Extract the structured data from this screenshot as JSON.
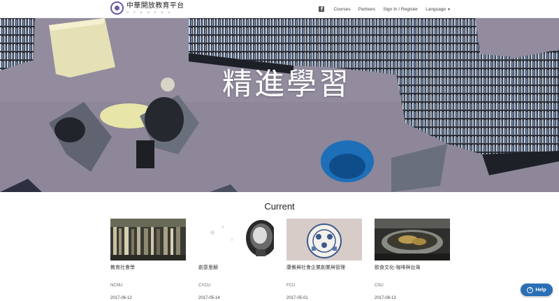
{
  "header": {
    "logo_title": "中華開放教育平台",
    "logo_sub": "O P E N E D U",
    "nav": {
      "facebook_icon": "facebook-icon",
      "courses": "Courses",
      "partners": "Partners",
      "signin": "Sign In / Register",
      "language": "Language"
    }
  },
  "hero": {
    "title": "精進學習"
  },
  "section": {
    "title": "Current"
  },
  "courses": [
    {
      "name": "教育社會學",
      "org": "NCNU",
      "date": "2017-06-12"
    },
    {
      "name": "創意思解",
      "org": "CYCU",
      "date": "2017-05-14"
    },
    {
      "name": "康餐與社會企業創業與管理",
      "org": "FCU",
      "date": "2017-05-01"
    },
    {
      "name": "飲食文化-咖啡與台灣",
      "org": "CSU",
      "date": "2017-08-13"
    }
  ],
  "help": {
    "label": "Help",
    "icon": "question-icon"
  },
  "colors": {
    "accent": "#2a6fb5",
    "brand": "#6b5aa8"
  }
}
